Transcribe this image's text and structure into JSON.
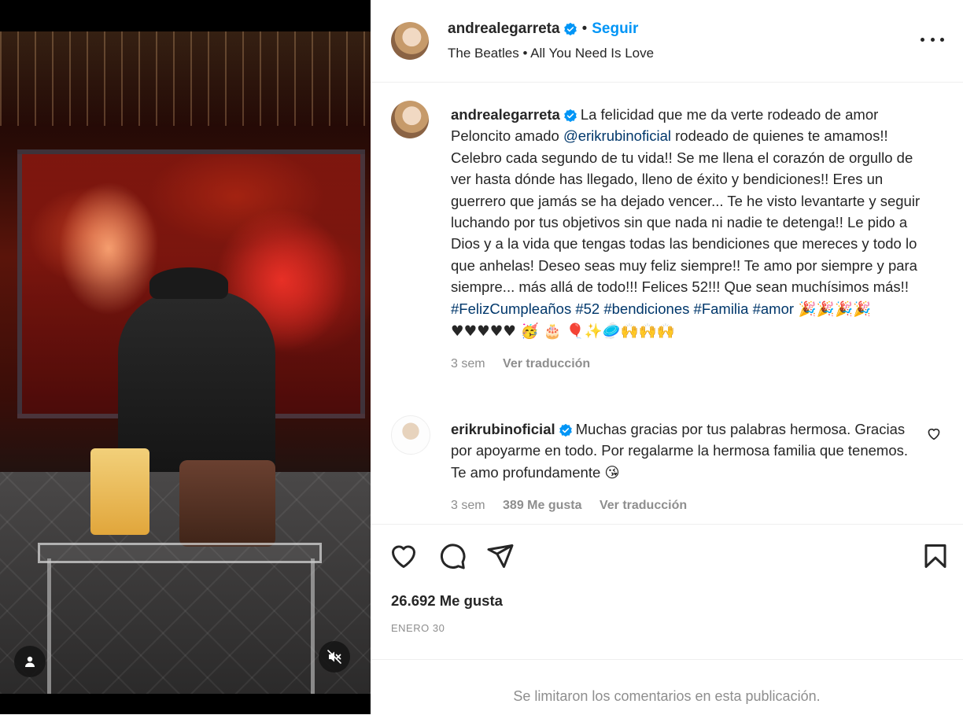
{
  "post": {
    "author": "andrealegarreta",
    "follow_label": "Seguir",
    "audio": "The Beatles • All You Need Is Love",
    "more_label": "Más opciones"
  },
  "caption": {
    "username": "andrealegarreta",
    "text_1": "La felicidad que me da verte rodeado de amor Peloncito amado ",
    "mention": "@erikrubinoficial",
    "text_2": " rodeado de quienes te amamos!! Celebro cada segundo de tu vida!! Se me llena el corazón de orgullo de ver hasta dónde has llegado, lleno de éxito y bendiciones!! Eres un guerrero que jamás se ha dejado vencer... Te he visto levantarte y seguir luchando por tus objetivos sin que nada ni nadie te detenga!! Le pido a Dios y a la vida que tengas todas las bendiciones que mereces y todo lo que anhelas! Deseo seas muy feliz siempre!! Te amo por siempre y para siempre... más allá de todo!!! Felices 52!!! Que sean muchísimos más!! ",
    "hashtags": "#FelizCumpleaños #52 #bendiciones #Familia #amor",
    "emojis": " 🎉🎉🎉🎉♥♥♥♥♥ 🥳 🎂 🎈✨🥏🙌🙌🙌",
    "time": "3 sem",
    "translate": "Ver traducción"
  },
  "comment": {
    "username": "erikrubinoficial",
    "text": "Muchas gracias por tus palabras hermosa. Gracias por apoyarme en todo. Por regalarme la hermosa familia que tenemos. Te amo profundamente",
    "emoji": "😘",
    "time": "3 sem",
    "likes": "389 Me gusta",
    "translate": "Ver traducción"
  },
  "stats": {
    "likes": "26.692 Me gusta",
    "date": "ENERO 30"
  },
  "footer": {
    "limited": "Se limitaron los comentarios en esta publicación."
  },
  "colors": {
    "link": "#0095f6",
    "verified": "#0095f6",
    "hashtag": "#00376b",
    "muted": "#8e8e8e"
  }
}
